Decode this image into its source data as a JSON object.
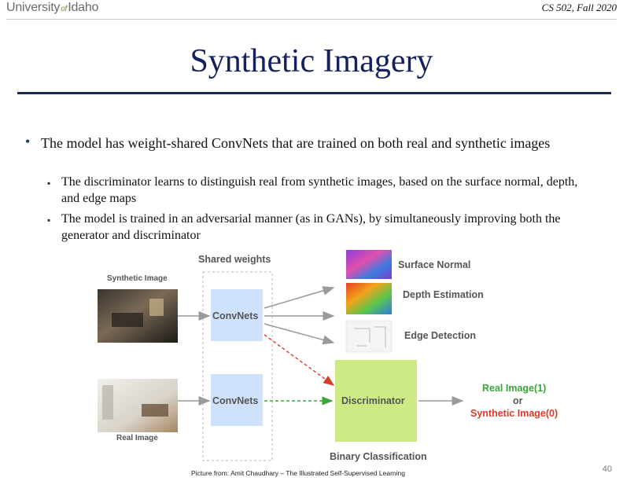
{
  "header": {
    "logo_left": "University",
    "logo_of": "of",
    "logo_right": "Idaho",
    "course": "CS 502, Fall 2020"
  },
  "slide": {
    "title": "Synthetic Imagery",
    "bullets": [
      {
        "text": "The model has weight-shared ConvNets that are trained on both real and synthetic images",
        "sub": [
          "The discriminator learns to distinguish real from synthetic images, based on the surface normal, depth, and edge maps",
          "The model is trained in an adversarial manner (as in GANs), by simultaneously improving both the generator and discriminator"
        ]
      }
    ]
  },
  "figure": {
    "shared_weights": "Shared weights",
    "synthetic_image": "Synthetic Image",
    "real_image": "Real Image",
    "convnets_top": "ConvNets",
    "convnets_bottom": "ConvNets",
    "surface_normal": "Surface Normal",
    "depth_estimation": "Depth Estimation",
    "edge_detection": "Edge Detection",
    "discriminator": "Discriminator",
    "binary_classification": "Binary Classification",
    "out_real": "Real Image(1)",
    "out_or": "or",
    "out_synthetic": "Synthetic Image(0)",
    "colors": {
      "convnet_fill": "#cfe2fb",
      "discriminator_fill": "#cdea85",
      "real_green": "#3aa63a",
      "synthetic_red": "#d93b2b",
      "arrow_gray": "#9a9a9a"
    }
  },
  "footer": {
    "credit": "Picture from: Amit Chaudhary – The Illustrated Self-Supervised Learning",
    "page": "40"
  }
}
